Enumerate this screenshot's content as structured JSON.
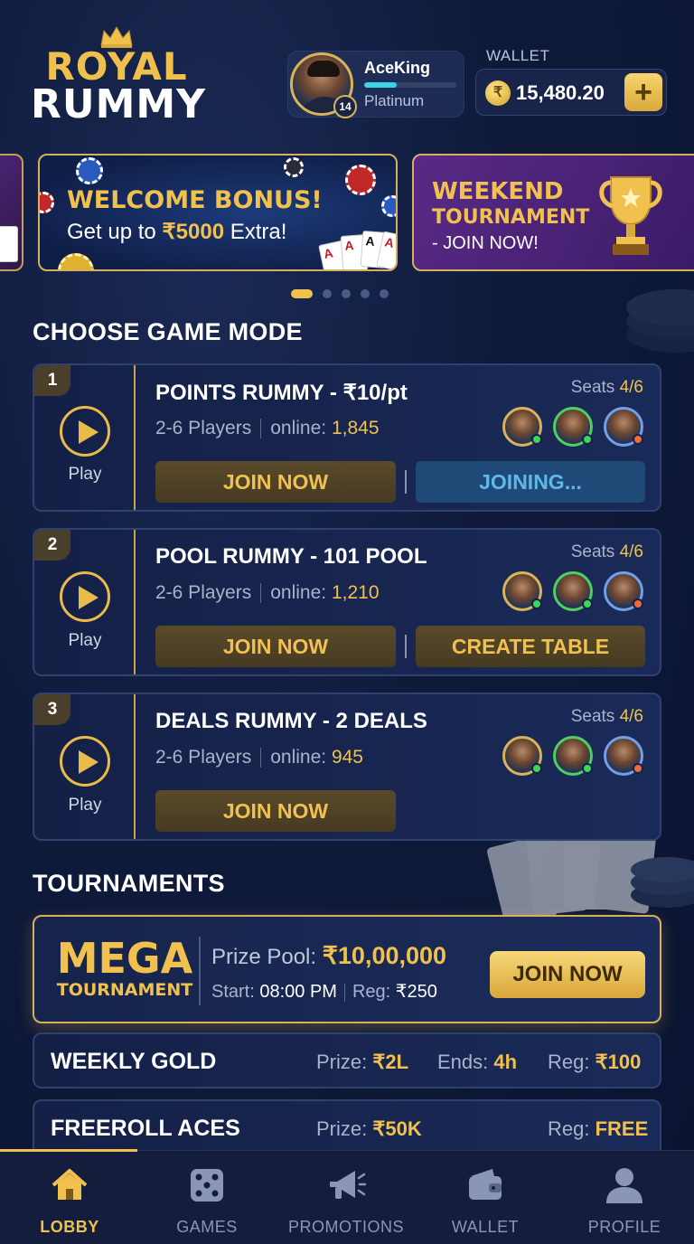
{
  "app": {
    "logo_line1": "ROYAL",
    "logo_line2": "RUMMY"
  },
  "profile": {
    "name": "AceKing",
    "tier": "Platinum",
    "level": "14",
    "xp_progress": 0.35
  },
  "wallet": {
    "label": "WALLET",
    "currency_symbol": "₹",
    "balance": "15,480.20",
    "add_label": "+"
  },
  "banners": [
    {
      "title": "WELCOME BONUS!",
      "subtitle": "Get up to ₹5000 Extra!",
      "subtitle_pre": "Get up to ",
      "subtitle_amount": "₹5000",
      "subtitle_post": " Extra!"
    },
    {
      "title_line1": "WEEKEND",
      "title_line2": "TOURNAMENT",
      "subtitle": "- JOIN NOW!"
    }
  ],
  "carousel": {
    "count": 5,
    "active": 0
  },
  "game_modes": {
    "section_title": "CHOOSE GAME MODE",
    "play_label": "Play",
    "players_label": "2-6 Players",
    "online_label": "online:",
    "seats_label": "Seats",
    "items": [
      {
        "num": "1",
        "title": "POINTS RUMMY - ₹10/pt",
        "online": "1,845",
        "seats": "4/6",
        "join_label": "JOIN NOW",
        "secondary_label": "JOINING..."
      },
      {
        "num": "2",
        "title": "POOL RUMMY - 101 POOL",
        "online": "1,210",
        "seats": "4/6",
        "join_label": "JOIN NOW",
        "secondary_label": "CREATE TABLE"
      },
      {
        "num": "3",
        "title": "DEALS RUMMY - 2 DEALS",
        "online": "945",
        "seats": "4/6",
        "join_label": "JOIN NOW"
      }
    ]
  },
  "tournaments": {
    "section_title": "TOURNAMENTS",
    "mega": {
      "title1": "MEGA",
      "title2": "TOURNAMENT",
      "prize_label": "Prize Pool:",
      "prize_value": "₹10,00,000",
      "start_label": "Start:",
      "start_value": "08:00 PM",
      "reg_label": "Reg:",
      "reg_value": "₹250",
      "join_label": "JOIN NOW"
    },
    "rows": [
      {
        "name": "WEEKLY GOLD",
        "prize_label": "Prize:",
        "prize": "₹2L",
        "ends_label": "Ends:",
        "ends": "4h",
        "reg_label": "Reg:",
        "reg": "₹100"
      },
      {
        "name": "FREEROLL ACES",
        "prize_label": "Prize:",
        "prize": "₹50K",
        "reg_label": "Reg:",
        "reg": "FREE"
      }
    ]
  },
  "nav": {
    "items": [
      {
        "label": "LOBBY",
        "icon": "home-icon",
        "active": true
      },
      {
        "label": "GAMES",
        "icon": "dice-icon"
      },
      {
        "label": "PROMOTIONS",
        "icon": "megaphone-icon"
      },
      {
        "label": "WALLET",
        "icon": "wallet-icon"
      },
      {
        "label": "PROFILE",
        "icon": "person-icon"
      }
    ]
  },
  "colors": {
    "accent_gold": "#f1c14f",
    "background": "#0f1a3a",
    "online_dot": "#3fd45a",
    "away_dot": "#ef6a3a",
    "joining_blue": "#5fb8e8"
  }
}
